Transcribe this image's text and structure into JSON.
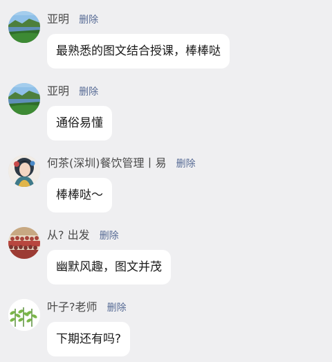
{
  "delete_label": "删除",
  "comments": [
    {
      "username": "亚明",
      "text": "最熟悉的图文结合授课，棒棒哒",
      "avatar": "landscape-lake-avatar"
    },
    {
      "username": "亚明",
      "text": "通俗易懂",
      "avatar": "landscape-lake-avatar"
    },
    {
      "username": "何茶(深圳)餐饮管理丨易",
      "text": "棒棒哒～",
      "avatar": "illustrated-woman-avatar"
    },
    {
      "username": "从? 出发",
      "text": "幽默风趣，图文并茂",
      "avatar": "group-photo-avatar"
    },
    {
      "username": "叶子?老师",
      "text": "下期还有吗?",
      "avatar": "green-leaves-avatar"
    }
  ],
  "colors": {
    "background": "#efeff1",
    "bubble": "#ffffff",
    "username": "#4a4a4a",
    "delete_link": "#576b95",
    "message_text": "#1a1a1a"
  }
}
